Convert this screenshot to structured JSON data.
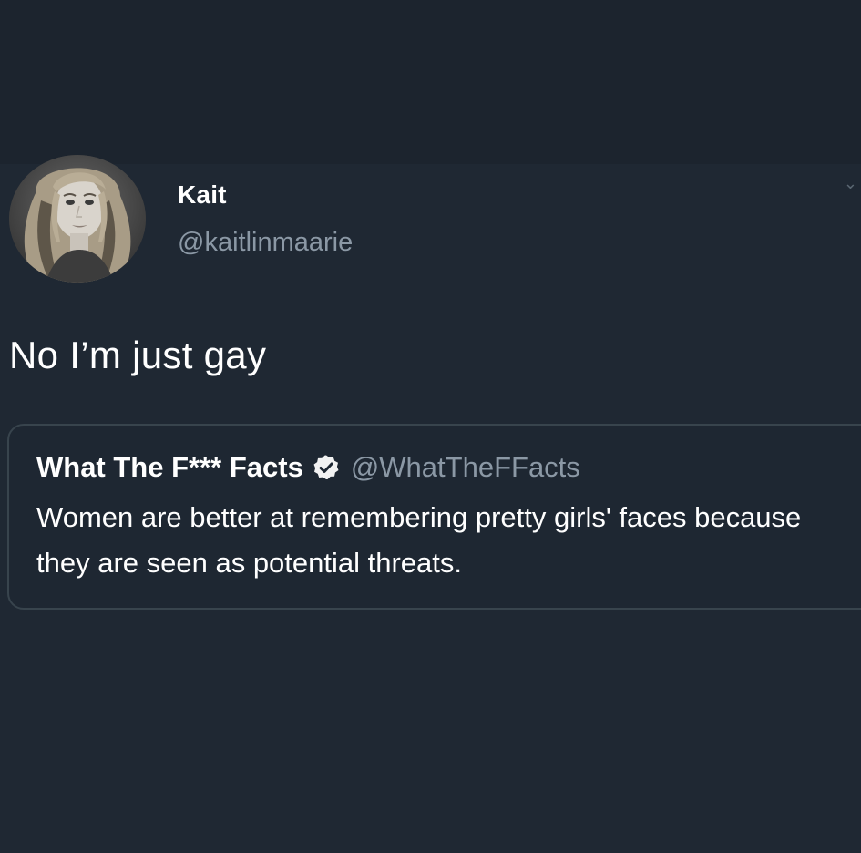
{
  "author": {
    "name": "Kait",
    "handle": "@kaitlinmaarie",
    "avatar": "profile-photo"
  },
  "tweet": {
    "text": "No I’m just gay"
  },
  "quoted_tweet": {
    "name": "What The F*** Facts",
    "verified": true,
    "handle": "@WhatTheFFacts",
    "text": "Women are better at remembering pretty girls' faces because they are seen as potential threats."
  },
  "colors": {
    "background": "#1e2732",
    "secondary_text": "#8b98a5",
    "border": "#38444d"
  }
}
